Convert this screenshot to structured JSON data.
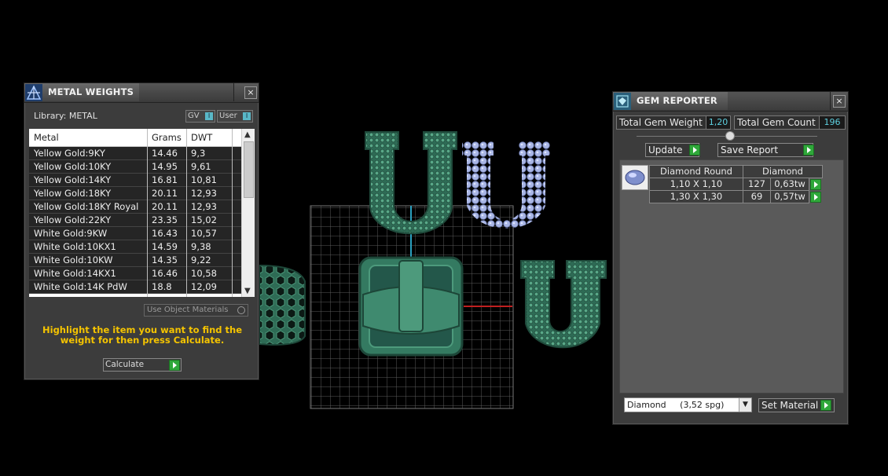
{
  "metal_weights": {
    "title": "METAL WEIGHTS",
    "close": "×",
    "library_label": "Library: METAL",
    "gv_label": "GV",
    "user_label": "User",
    "toggle_glyph": "I",
    "columns": [
      "Metal",
      "Grams",
      "DWT"
    ],
    "rows": [
      {
        "metal": "Yellow Gold:9KY",
        "grams": "14.46",
        "dwt": "9,3"
      },
      {
        "metal": "Yellow Gold:10KY",
        "grams": "14.95",
        "dwt": "9,61"
      },
      {
        "metal": "Yellow Gold:14KY",
        "grams": "16.81",
        "dwt": "10,81"
      },
      {
        "metal": "Yellow Gold:18KY",
        "grams": "20.11",
        "dwt": "12,93"
      },
      {
        "metal": "Yellow Gold:18KY Royal",
        "grams": "20.11",
        "dwt": "12,93"
      },
      {
        "metal": "Yellow Gold:22KY",
        "grams": "23.35",
        "dwt": "15,02"
      },
      {
        "metal": "White Gold:9KW",
        "grams": "16.43",
        "dwt": "10,57"
      },
      {
        "metal": "White Gold:10KX1",
        "grams": "14.59",
        "dwt": "9,38"
      },
      {
        "metal": "White Gold:10KW",
        "grams": "14.35",
        "dwt": "9,22"
      },
      {
        "metal": "White Gold:14KX1",
        "grams": "16.46",
        "dwt": "10,58"
      },
      {
        "metal": "White Gold:14K PdW",
        "grams": "18.8",
        "dwt": "12,09"
      }
    ],
    "scroll_up": "▲",
    "scroll_down": "▼",
    "use_object_materials": "Use Object Materials",
    "hint": "Highlight the item you want to find the weight for then press Calculate.",
    "calculate": "Calculate"
  },
  "gem_reporter": {
    "title": "GEM REPORTER",
    "close": "×",
    "total_gem_weight_label": "Total Gem Weight",
    "total_gem_weight_value": "1,20",
    "total_gem_count_label": "Total Gem Count",
    "total_gem_count_value": "196",
    "update": "Update",
    "save_report": "Save Report",
    "gem_shape": "Diamond Round",
    "gem_material": "Diamond",
    "gems": [
      {
        "size": "1,10 X 1,10",
        "count": "127",
        "weight": "0,63tw"
      },
      {
        "size": "1,30 X 1,30",
        "count": "69",
        "weight": "0,57tw"
      }
    ],
    "material_select": "Diamond     (3,52 spg)",
    "set_material": "Set Material"
  },
  "colors": {
    "background": "#000000",
    "model_green": "#3f8a6f",
    "gem_blue": "#a9b6e6",
    "hint_yellow": "#f5c400",
    "value_cyan": "#5ed0e0",
    "go_green": "#2fa83a"
  }
}
